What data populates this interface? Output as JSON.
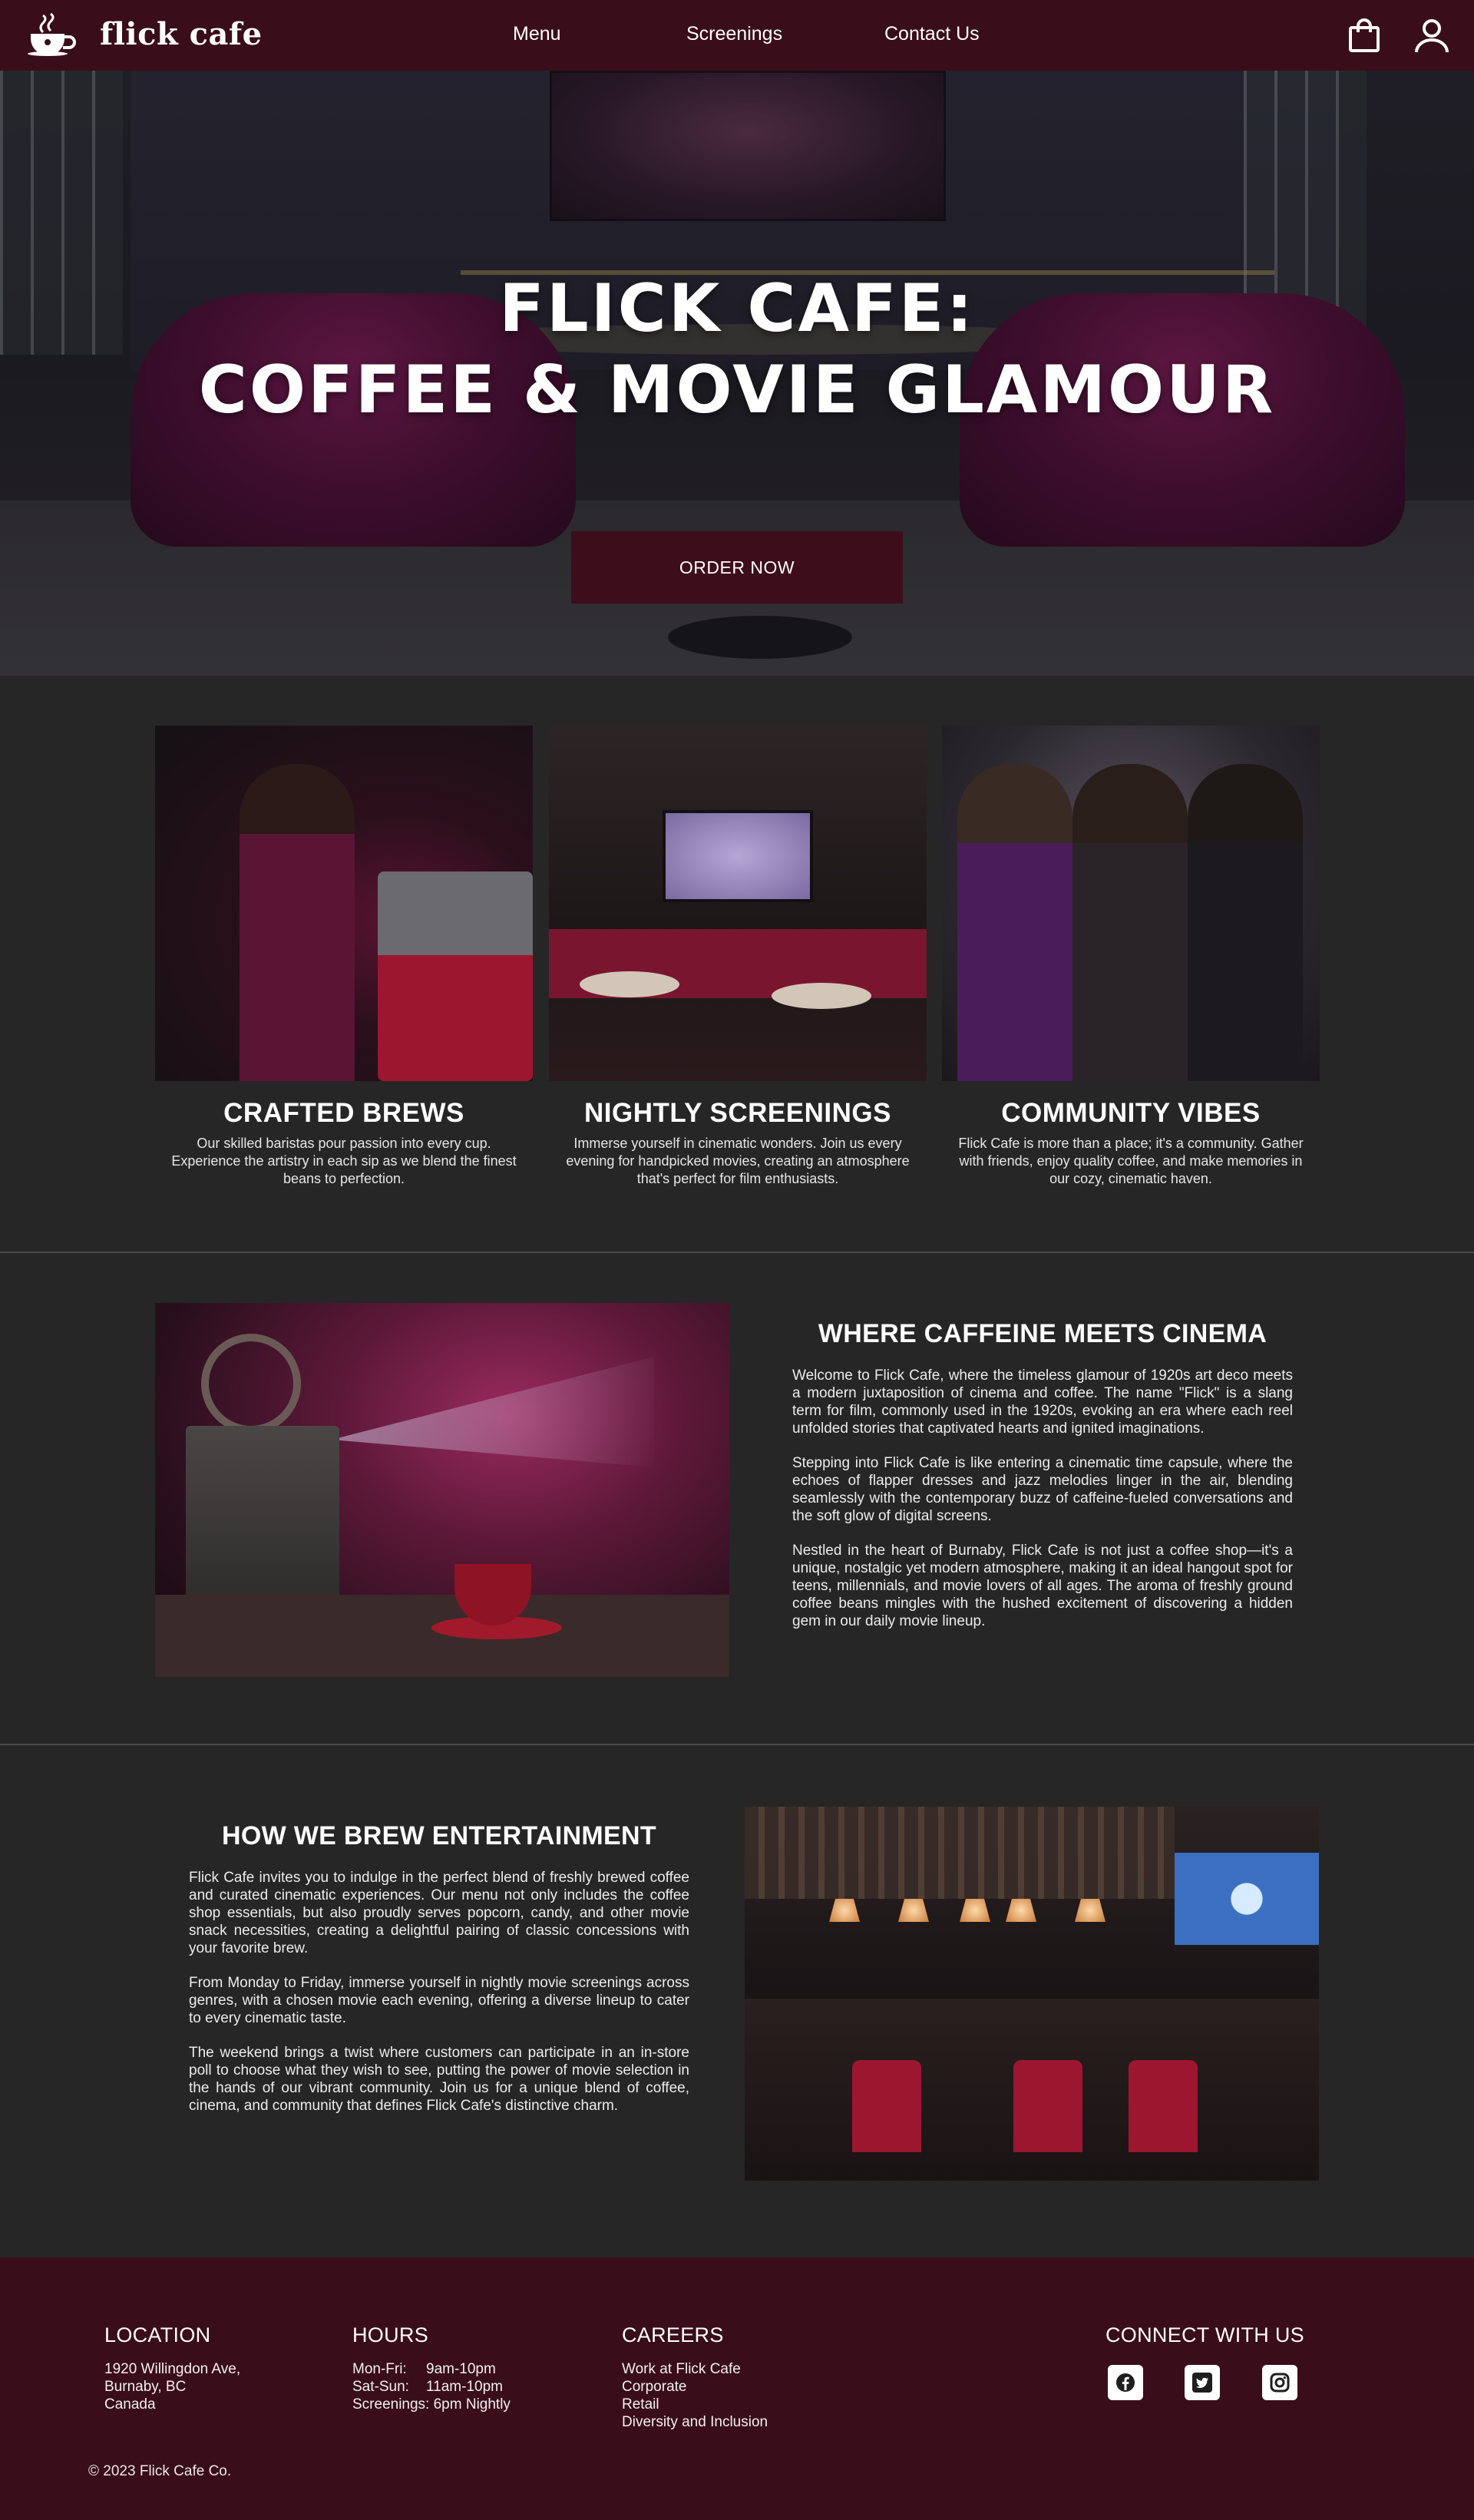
{
  "brand": {
    "name": "flick cafe",
    "logo_icon": "coffee-cup-icon"
  },
  "nav": {
    "links": [
      "Menu",
      "Screenings",
      "Contact Us"
    ],
    "icons": [
      "shopping-bag-icon",
      "user-icon"
    ]
  },
  "hero": {
    "title_line1": "FLICK CAFE:",
    "title_line2": "COFFEE & MOVIE GLAMOUR",
    "cta": "ORDER NOW"
  },
  "features": [
    {
      "title": "CRAFTED BREWS",
      "desc": "Our skilled baristas pour passion into every cup. Experience the artistry in each sip as we blend the finest beans to perfection."
    },
    {
      "title": "NIGHTLY SCREENINGS",
      "desc": "Immerse yourself in cinematic wonders. Join us every evening for handpicked movies, creating an atmosphere that's perfect for film enthusiasts."
    },
    {
      "title": "COMMUNITY VIBES",
      "desc": "Flick Cafe is more than a place; it's a community. Gather with friends, enjoy quality coffee, and make memories in our cozy, cinematic haven."
    }
  ],
  "about": {
    "title": "WHERE CAFFEINE MEETS CINEMA",
    "paragraphs": [
      "Welcome to Flick Cafe, where the timeless glamour of 1920s art deco meets a modern juxtaposition of cinema and coffee. The name \"Flick\" is a slang term for film, commonly used in the 1920s, evoking an era where each reel unfolded stories that captivated hearts and ignited imaginations.",
      "Stepping into Flick Cafe is like entering a cinematic time capsule, where the echoes of flapper dresses and jazz melodies linger in the air, blending seamlessly with the contemporary buzz of caffeine-fueled conversations and the soft glow of digital screens.",
      "Nestled in the heart of Burnaby, Flick Cafe is not just a coffee shop—it's a unique, nostalgic yet modern atmosphere, making it an ideal hangout spot for teens, millennials, and movie lovers of all ages. The aroma of freshly ground coffee beans mingles with the hushed excitement of discovering a hidden gem in our daily movie lineup."
    ]
  },
  "brew": {
    "title": "HOW WE BREW ENTERTAINMENT",
    "paragraphs": [
      "Flick Cafe invites you to indulge in the perfect blend of freshly brewed coffee and curated cinematic experiences. Our menu not only includes the coffee shop essentials, but also proudly serves popcorn, candy, and other movie snack necessities, creating a delightful pairing of classic concessions with your favorite brew.",
      "From Monday to Friday, immerse yourself in nightly movie screenings across genres, with a chosen movie each evening, offering a diverse lineup to cater to every cinematic taste.",
      "The weekend brings a twist where customers can participate in an in-store poll to choose what they wish to see, putting the power of movie selection in the hands of our vibrant community. Join us for a unique blend of coffee, cinema, and community that defines Flick Cafe's distinctive charm."
    ]
  },
  "footer": {
    "location": {
      "heading": "LOCATION",
      "lines": [
        "1920 Willingdon Ave,",
        "Burnaby, BC",
        "Canada"
      ]
    },
    "hours": {
      "heading": "HOURS",
      "rows": [
        {
          "label": "Mon-Fri:",
          "value": "9am-10pm"
        },
        {
          "label": "Sat-Sun:",
          "value": "11am-10pm"
        }
      ],
      "extra": "Screenings: 6pm Nightly"
    },
    "careers": {
      "heading": "CAREERS",
      "links": [
        "Work at Flick Cafe",
        "Corporate",
        "Retail",
        "Diversity and Inclusion"
      ]
    },
    "social": {
      "heading": "CONNECT WITH US",
      "icons": [
        "facebook-icon",
        "twitter-icon",
        "instagram-icon"
      ]
    },
    "copyright": "© 2023 Flick Cafe Co."
  },
  "colors": {
    "brand": "#3a0d1b",
    "background": "#262626",
    "text": "#ffffff"
  }
}
